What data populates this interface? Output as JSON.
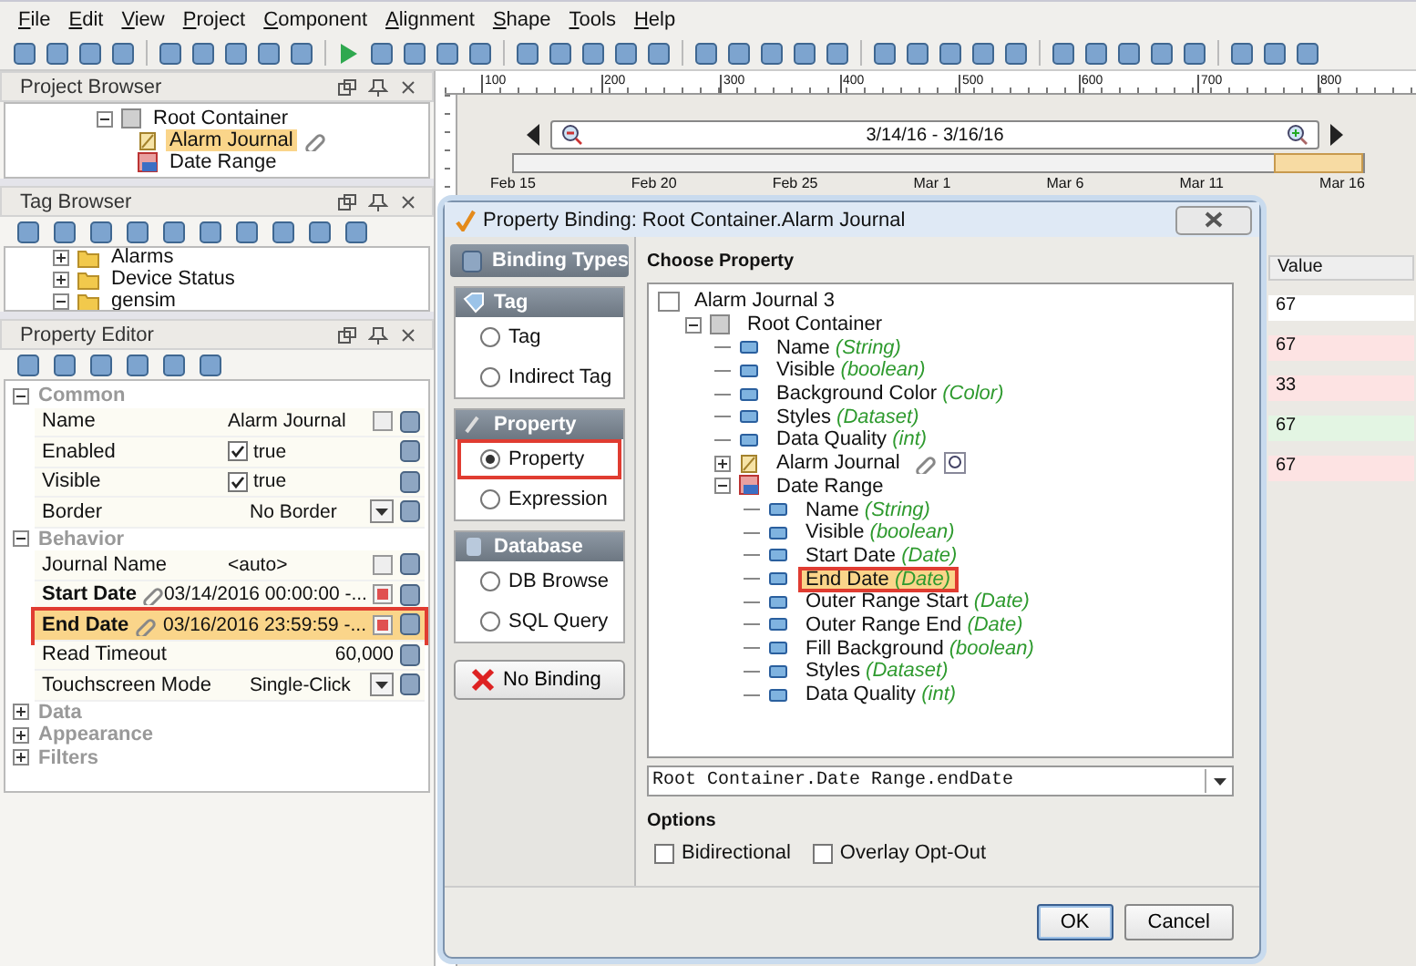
{
  "menu": [
    "File",
    "Edit",
    "View",
    "Project",
    "Component",
    "Alignment",
    "Shape",
    "Tools",
    "Help"
  ],
  "project_browser": {
    "title": "Project Browser",
    "items": [
      {
        "label": "Root Container",
        "kind": "container",
        "expanded": true,
        "selected": false,
        "children": [
          {
            "label": "Alarm Journal",
            "kind": "journal",
            "selected": true,
            "bound": true
          },
          {
            "label": "Date Range",
            "kind": "daterange",
            "selected": false,
            "bound": false
          }
        ]
      }
    ]
  },
  "tag_browser": {
    "title": "Tag Browser",
    "items": [
      {
        "label": "Alarms",
        "expanded": false
      },
      {
        "label": "Device Status",
        "expanded": false
      },
      {
        "label": "gensim",
        "expanded": true
      }
    ]
  },
  "property_editor": {
    "title": "Property Editor",
    "sections": [
      {
        "name": "Common",
        "expanded": true,
        "rows": [
          {
            "name": "Name",
            "kind": "text",
            "value": "Alarm Journal",
            "bound": false,
            "selected": false,
            "annotated": false
          },
          {
            "name": "Enabled",
            "kind": "check",
            "value": "true",
            "checked": true,
            "bound": false,
            "selected": false,
            "annotated": false
          },
          {
            "name": "Visible",
            "kind": "check",
            "value": "true",
            "checked": true,
            "bound": false,
            "selected": false,
            "annotated": false
          },
          {
            "name": "Border",
            "kind": "dropdown",
            "value": "No Border",
            "bound": false,
            "selected": false,
            "annotated": false
          }
        ]
      },
      {
        "name": "Behavior",
        "expanded": true,
        "rows": [
          {
            "name": "Journal Name",
            "kind": "text",
            "value": "<auto>",
            "bound": false,
            "selected": false,
            "annotated": false
          },
          {
            "name": "Start Date",
            "kind": "date",
            "value": "03/14/2016 00:00:00 -...",
            "bound": true,
            "selected": false,
            "annotated": false
          },
          {
            "name": "End Date",
            "kind": "date",
            "value": "03/16/2016 23:59:59 -...",
            "bound": true,
            "selected": true,
            "annotated": true
          },
          {
            "name": "Read Timeout",
            "kind": "number",
            "value": "60,000",
            "bound": false,
            "selected": false,
            "annotated": false
          },
          {
            "name": "Touchscreen Mode",
            "kind": "dropdown",
            "value": "Single-Click",
            "bound": false,
            "selected": false,
            "annotated": false
          }
        ]
      },
      {
        "name": "Data",
        "expanded": false
      },
      {
        "name": "Appearance",
        "expanded": false
      },
      {
        "name": "Filters",
        "expanded": false
      }
    ]
  },
  "ruler": {
    "labels": [
      "100",
      "200",
      "300",
      "400",
      "500",
      "600",
      "700",
      "800"
    ]
  },
  "date_range": {
    "range_text": "3/14/16 - 3/16/16",
    "selection": {
      "level": 0.1
    },
    "dates": [
      "Feb 15",
      "Feb 20",
      "Feb 25",
      "Mar 1",
      "Mar 6",
      "Mar 11",
      "Mar 16"
    ]
  },
  "table": {
    "columns": [
      "Value"
    ],
    "rows": [
      {
        "value": "67",
        "color": "#ffffff"
      },
      {
        "value": "67",
        "color": "#fde3e3"
      },
      {
        "value": "33",
        "color": "#fde3e3"
      },
      {
        "value": "67",
        "color": "#e3f5e3"
      },
      {
        "value": "67",
        "color": "#fde3e3"
      }
    ]
  },
  "dialog": {
    "title": "Property Binding: Root Container.Alarm Journal",
    "binding_types_title": "Binding Types",
    "groups": [
      {
        "title": "Tag",
        "kind": "tag",
        "options": [
          {
            "label": "Tag",
            "selected": false,
            "annotated": false
          },
          {
            "label": "Indirect Tag",
            "selected": false,
            "annotated": false
          }
        ]
      },
      {
        "title": "Property",
        "kind": "property",
        "options": [
          {
            "label": "Property",
            "selected": true,
            "annotated": true
          },
          {
            "label": "Expression",
            "selected": false,
            "annotated": false
          }
        ]
      },
      {
        "title": "Database",
        "kind": "database",
        "options": [
          {
            "label": "DB Browse",
            "selected": false,
            "annotated": false
          },
          {
            "label": "SQL Query",
            "selected": false,
            "annotated": false
          }
        ]
      }
    ],
    "no_binding_button": "No Binding",
    "choose_property_label": "Choose Property",
    "tree": [
      {
        "name": "Alarm Journal 3",
        "kind": "window",
        "selected": false,
        "annotated": false,
        "children": [
          {
            "name": "Root Container",
            "kind": "container",
            "expanded": true,
            "selected": false,
            "annotated": false,
            "children": [
              {
                "name": "Name",
                "type": "(String)",
                "kind": "property",
                "selected": false,
                "annotated": false
              },
              {
                "name": "Visible",
                "type": "(boolean)",
                "kind": "property",
                "selected": false,
                "annotated": false
              },
              {
                "name": "Background Color",
                "type": "(Color)",
                "kind": "property",
                "selected": false,
                "annotated": false
              },
              {
                "name": "Styles",
                "type": "(Dataset)",
                "kind": "property",
                "selected": false,
                "annotated": false
              },
              {
                "name": "Data Quality",
                "type": "(int)",
                "kind": "property",
                "selected": false,
                "annotated": false
              },
              {
                "name": "Alarm Journal",
                "kind": "journal",
                "expanded": false,
                "selected": false,
                "annotated": false
              },
              {
                "name": "Date Range",
                "kind": "daterange",
                "expanded": true,
                "selected": false,
                "annotated": false,
                "children": [
                  {
                    "name": "Name",
                    "type": "(String)",
                    "kind": "property",
                    "selected": false,
                    "annotated": false
                  },
                  {
                    "name": "Visible",
                    "type": "(boolean)",
                    "kind": "property",
                    "selected": false,
                    "annotated": false
                  },
                  {
                    "name": "Start Date",
                    "type": "(Date)",
                    "kind": "property",
                    "selected": false,
                    "annotated": false
                  },
                  {
                    "name": "End Date",
                    "type": "(Date)",
                    "kind": "property",
                    "selected": true,
                    "annotated": true
                  },
                  {
                    "name": "Outer Range Start",
                    "type": "(Date)",
                    "kind": "property",
                    "selected": false,
                    "annotated": false
                  },
                  {
                    "name": "Outer Range End",
                    "type": "(Date)",
                    "kind": "property",
                    "selected": false,
                    "annotated": false
                  },
                  {
                    "name": "Fill Background",
                    "type": "(boolean)",
                    "kind": "property",
                    "selected": false,
                    "annotated": false
                  },
                  {
                    "name": "Styles",
                    "type": "(Dataset)",
                    "kind": "property",
                    "selected": false,
                    "annotated": false
                  },
                  {
                    "name": "Data Quality",
                    "type": "(int)",
                    "kind": "property",
                    "selected": false,
                    "annotated": false
                  }
                ]
              }
            ]
          }
        ]
      }
    ],
    "path_value": "Root Container.Date Range.endDate",
    "options_label": "Options",
    "options": [
      {
        "label": "Bidirectional",
        "checked": false
      },
      {
        "label": "Overlay Opt-Out",
        "checked": false
      }
    ],
    "buttons": [
      {
        "label": "OK",
        "kind": "ok"
      },
      {
        "label": "Cancel",
        "kind": "cancel"
      }
    ]
  }
}
